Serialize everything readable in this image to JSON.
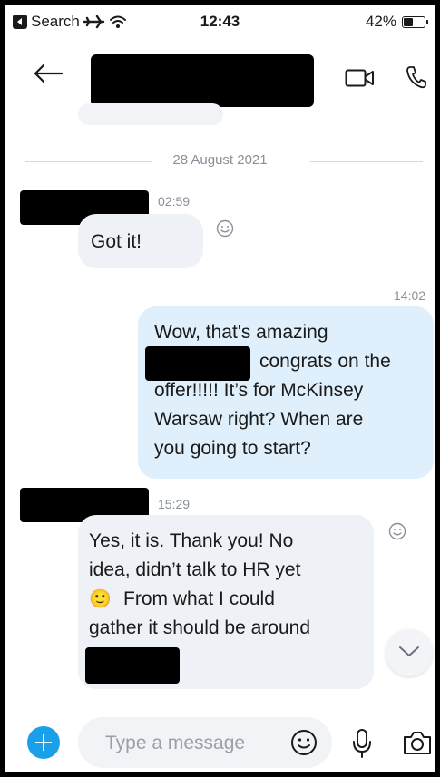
{
  "status_bar": {
    "back_app_label": "Search",
    "time": "12:43",
    "battery": "42%",
    "battery_level": 0.42
  },
  "header": {
    "contact_name": "",
    "icons": [
      "back-arrow-icon",
      "video-call-icon",
      "phone-call-icon"
    ]
  },
  "conversation": {
    "date_separator": "28 August 2021",
    "messages": [
      {
        "direction": "incoming",
        "sender": "",
        "time": "02:59",
        "lines": [
          "Got it!"
        ],
        "reaction_icon": "smiley-react-icon"
      },
      {
        "direction": "outgoing",
        "time": "14:02",
        "lines": [
          "Wow, that's amazing",
          "congrats on the",
          "offer!!!!! It’s for McKinsey",
          "Warsaw right? When are",
          "you going to start?"
        ]
      },
      {
        "direction": "incoming",
        "sender": "",
        "time": "15:29",
        "lines": [
          "Yes, it is. Thank you! No",
          "idea, didn’t talk to HR yet",
          "From what I could",
          "gather it should be around"
        ],
        "inline_emoji": "🙂",
        "reaction_icon": "smiley-react-icon"
      }
    ]
  },
  "composer": {
    "placeholder": "Type a message",
    "icons": [
      "add-icon",
      "emoji-icon",
      "microphone-icon",
      "camera-icon"
    ]
  },
  "colors": {
    "incoming_bubble": "#eef1f6",
    "outgoing_bubble": "#dff0fc",
    "accent": "#1aa0e8"
  }
}
